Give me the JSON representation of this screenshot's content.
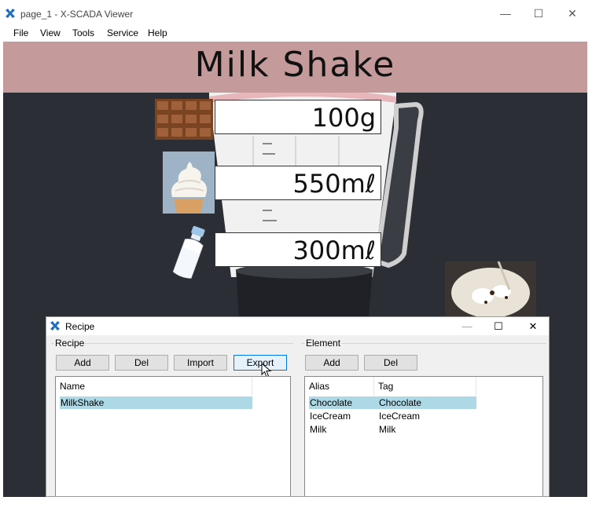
{
  "window": {
    "title": "page_1 - X-SCADA Viewer",
    "minimize": "—",
    "maximize": "☐",
    "close": "✕"
  },
  "menu": {
    "items": [
      "File",
      "View",
      "Tools",
      "Service",
      "Help"
    ]
  },
  "canvas": {
    "title": "Milk Shake",
    "ingredients": [
      {
        "name": "chocolate",
        "value": "100g"
      },
      {
        "name": "ice-cream",
        "value": "550mℓ"
      },
      {
        "name": "milk",
        "value": "300mℓ"
      }
    ]
  },
  "dialog": {
    "title": "Recipe",
    "minimize": "—",
    "maximize": "☐",
    "close": "✕",
    "recipe_group": {
      "label": "Recipe",
      "buttons": [
        "Add",
        "Del",
        "Import",
        "Export"
      ],
      "columns": [
        "Name"
      ],
      "rows": [
        {
          "name": "MilkShake",
          "selected": true
        }
      ]
    },
    "element_group": {
      "label": "Element",
      "buttons": [
        "Add",
        "Del"
      ],
      "columns": [
        "Alias",
        "Tag"
      ],
      "rows": [
        {
          "alias": "Chocolate",
          "tag": "Chocolate",
          "selected": true
        },
        {
          "alias": "IceCream",
          "tag": "IceCream",
          "selected": false
        },
        {
          "alias": "Milk",
          "tag": "Milk",
          "selected": false
        }
      ]
    }
  },
  "colors": {
    "banner": "#c49a9b",
    "background": "#2b2e35",
    "selection": "#add8e6",
    "app_icon": "#1e6fc0"
  }
}
